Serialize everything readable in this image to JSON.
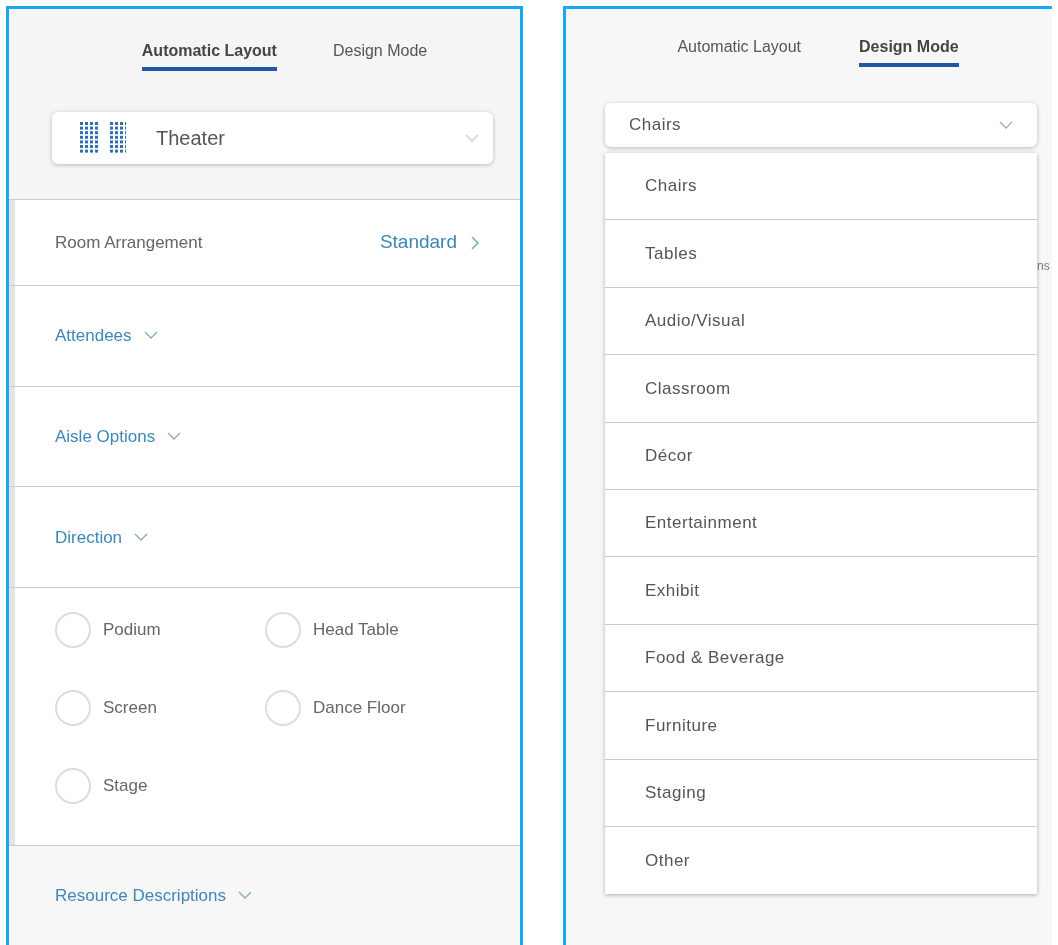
{
  "left_panel": {
    "tabs": [
      {
        "label": "Automatic Layout",
        "selected": true
      },
      {
        "label": "Design Mode",
        "selected": false
      }
    ],
    "layout_select": {
      "value": "Theater",
      "expanded": false
    },
    "room_arrangement": {
      "label": "Room Arrangement",
      "value": "Standard"
    },
    "sections": [
      {
        "label": "Attendees",
        "expanded": false
      },
      {
        "label": "Aisle Options",
        "expanded": false
      },
      {
        "label": "Direction",
        "expanded": false
      }
    ],
    "direction_options": [
      {
        "label": "Podium",
        "selected": false
      },
      {
        "label": "Head Table",
        "selected": false
      },
      {
        "label": "Screen",
        "selected": false
      },
      {
        "label": "Dance Floor",
        "selected": false
      },
      {
        "label": "Stage",
        "selected": false
      }
    ],
    "bottom_section": {
      "label": "Resource Descriptions",
      "expanded": false
    }
  },
  "right_panel": {
    "tabs": [
      {
        "label": "Automatic Layout",
        "selected": false
      },
      {
        "label": "Design Mode",
        "selected": true
      }
    ],
    "category_select": {
      "value": "Chairs",
      "expanded": true
    },
    "partial_text": "ns",
    "options": [
      {
        "label": "Chairs",
        "selected": false
      },
      {
        "label": "Tables",
        "selected": false
      },
      {
        "label": "Audio/Visual",
        "selected": false
      },
      {
        "label": "Classroom",
        "selected": false
      },
      {
        "label": "Décor",
        "selected": false
      },
      {
        "label": "Entertainment",
        "selected": false
      },
      {
        "label": "Exhibit",
        "selected": false
      },
      {
        "label": "Food & Beverage",
        "selected": false
      },
      {
        "label": "Furniture",
        "selected": false
      },
      {
        "label": "Staging",
        "selected": false
      },
      {
        "label": "Other",
        "selected": false
      }
    ]
  }
}
